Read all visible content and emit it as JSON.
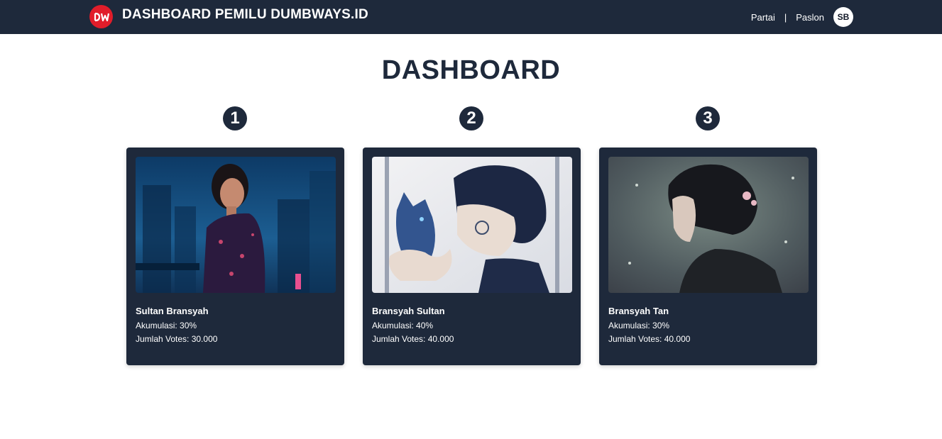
{
  "navbar": {
    "logo_text": "DW",
    "title": "DASHBOARD PEMILU DUMBWAYS.ID",
    "links": [
      "Partai",
      "Paslon"
    ],
    "separator": "|",
    "avatar": "SB"
  },
  "page": {
    "title": "DASHBOARD"
  },
  "candidates": [
    {
      "rank": "1",
      "name": "Sultan Bransyah",
      "akumulasi": "Akumulasi: 30%",
      "votes": "Jumlah Votes: 30.000"
    },
    {
      "rank": "2",
      "name": "Bransyah Sultan",
      "akumulasi": "Akumulasi: 40%",
      "votes": "Jumlah Votes: 40.000"
    },
    {
      "rank": "3",
      "name": "Bransyah Tan",
      "akumulasi": "Akumulasi: 30%",
      "votes": "Jumlah Votes: 40.000"
    }
  ],
  "colors": {
    "navbar": "#1e293b",
    "card": "#1e293b",
    "logo": "#e11d2a",
    "title": "#1e293b"
  }
}
